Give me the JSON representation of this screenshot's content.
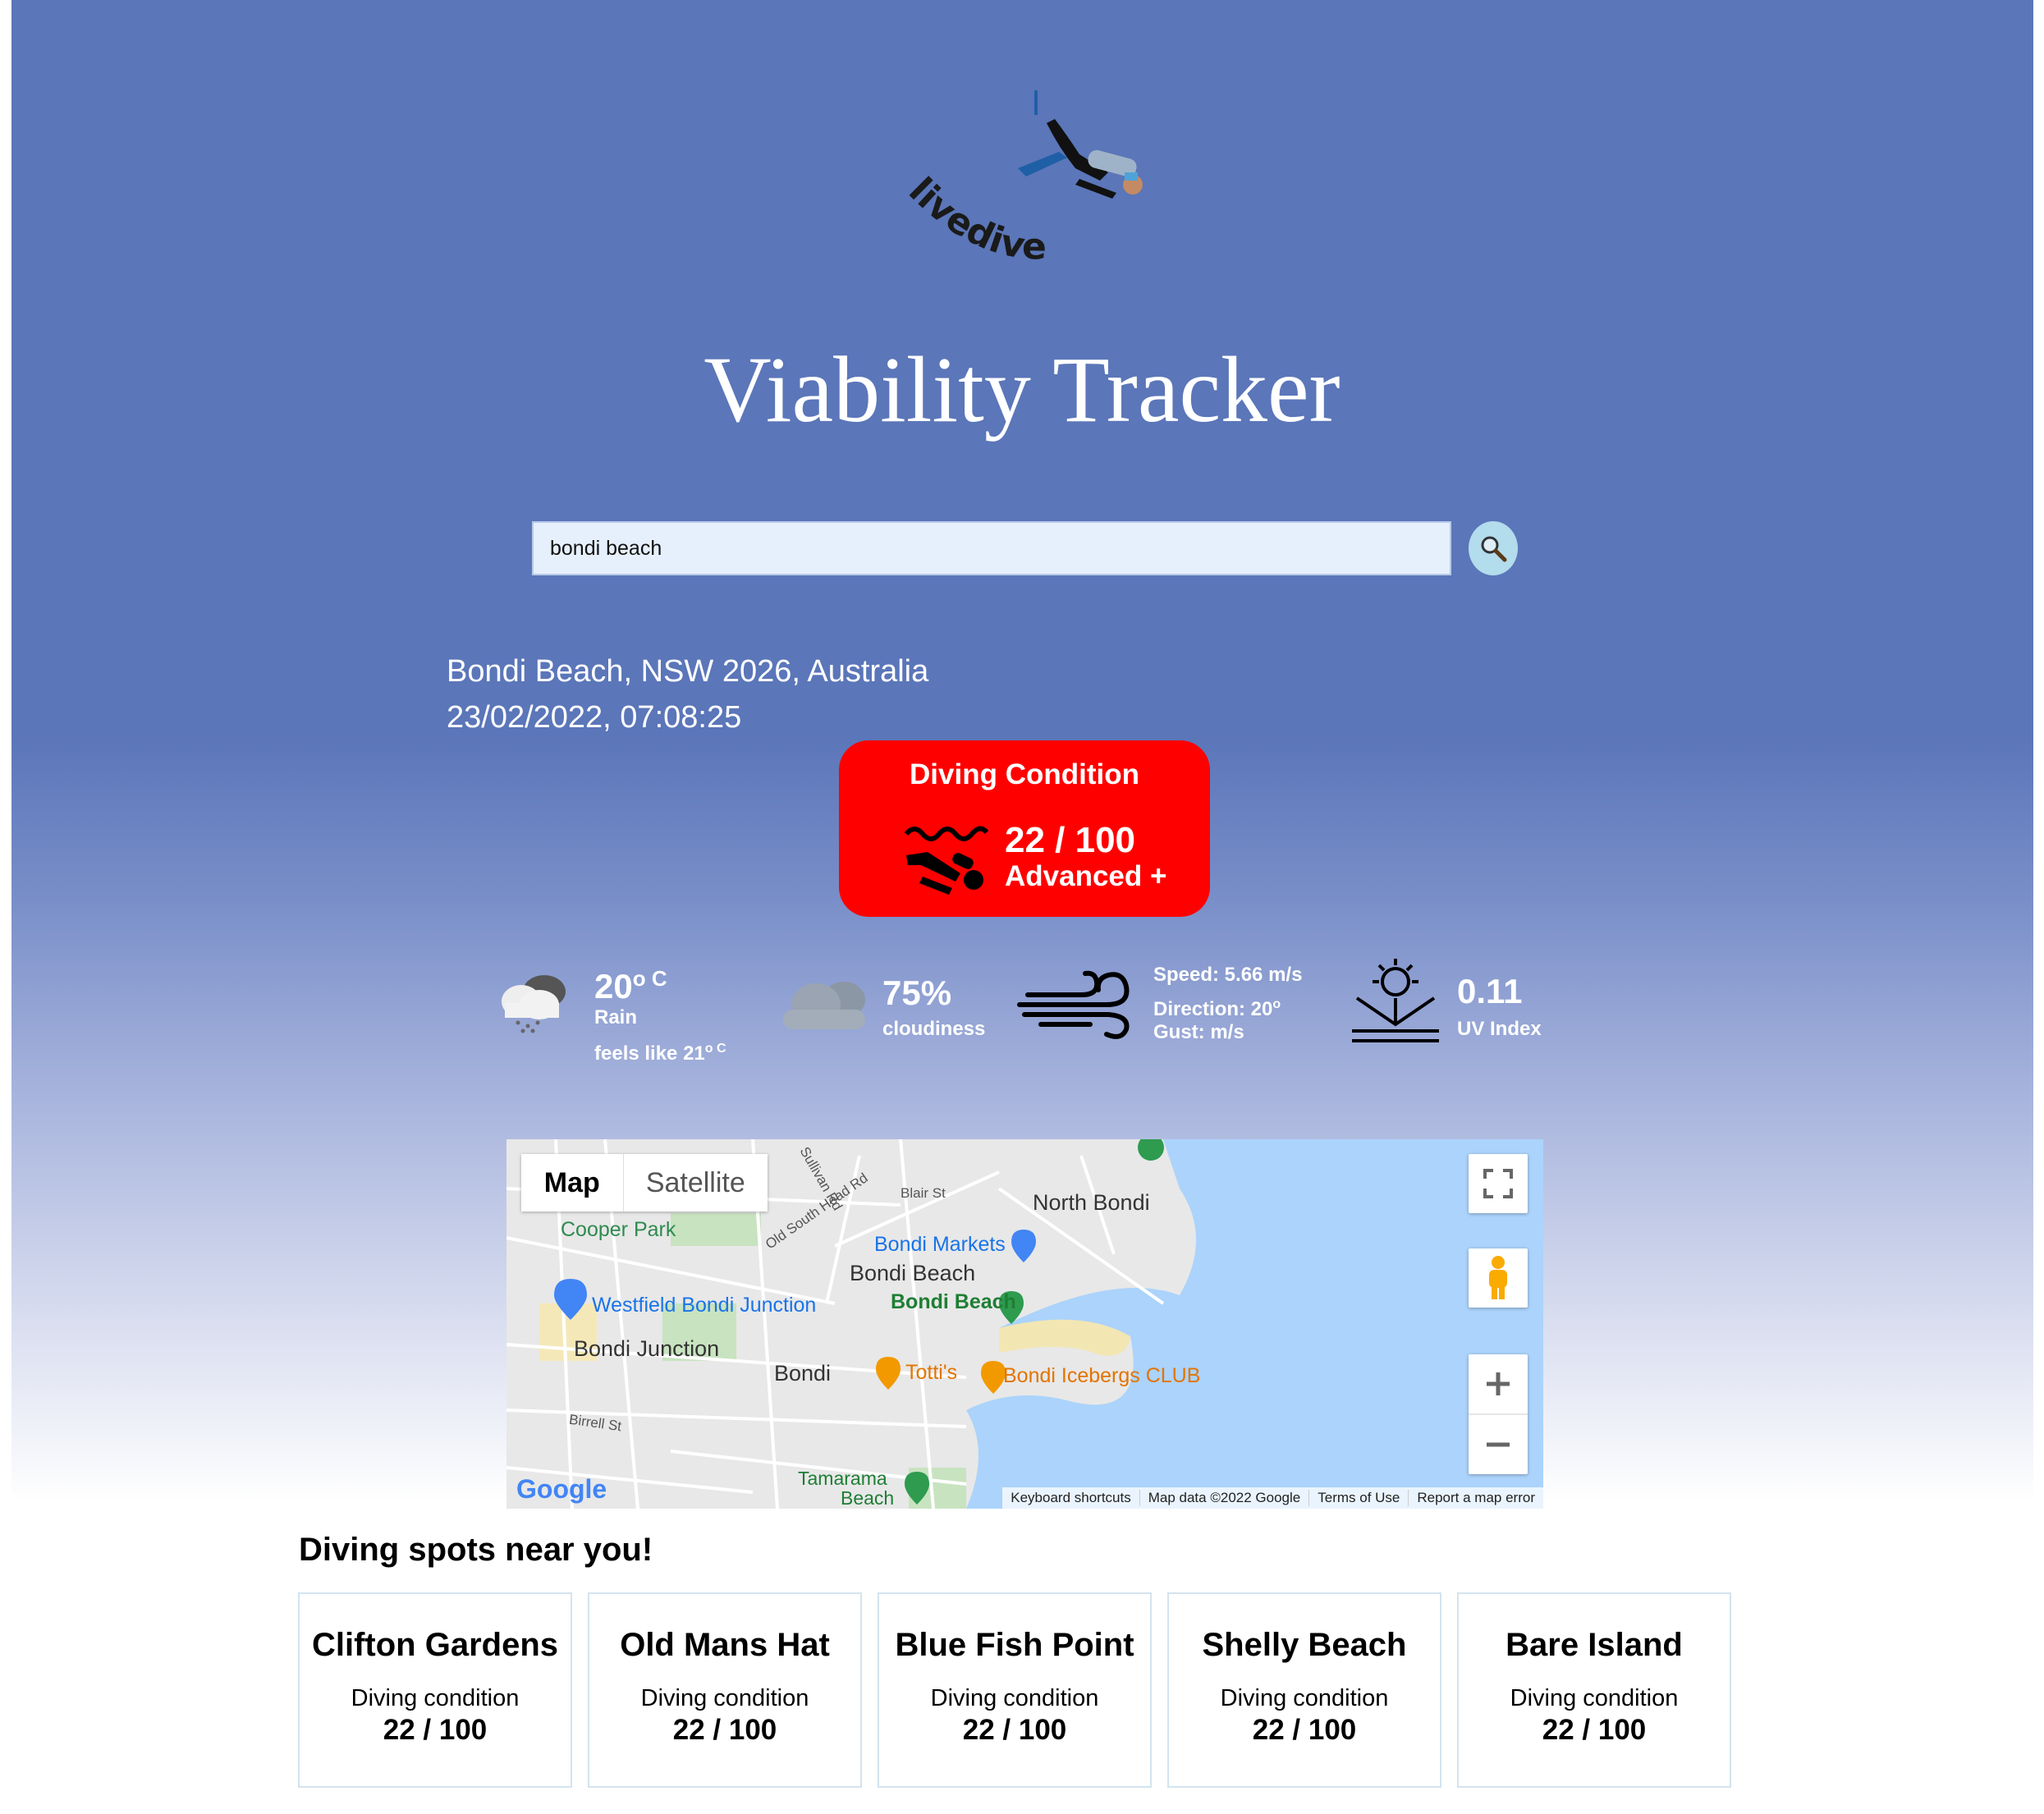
{
  "header": {
    "logo_text": "livedive",
    "title": "Viability Tracker"
  },
  "search": {
    "value": "bondi beach",
    "button_icon": "magnifier-icon"
  },
  "location": {
    "address": "Bondi Beach, NSW 2026, Australia",
    "datetime": "23/02/2022, 07:08:25"
  },
  "condition": {
    "title": "Diving Condition",
    "score": "22 / 100",
    "level": "Advanced +",
    "color": "#ff0000",
    "icon": "diver-icon"
  },
  "weather": {
    "temperature": {
      "icon": "rain-cloud-icon",
      "value": "20",
      "unit": "o C",
      "description": "Rain",
      "feels_like": "feels like 21",
      "feels_unit": "o C"
    },
    "cloudiness": {
      "icon": "cloud-icon",
      "value": "75%",
      "label": "cloudiness"
    },
    "wind": {
      "icon": "wind-icon",
      "speed": "Speed: 5.66 m/s",
      "direction": "Direction: 20",
      "direction_unit": "o",
      "gust": "Gust: m/s"
    },
    "uv": {
      "icon": "sunrise-icon",
      "value": "0.11",
      "label": "UV Index"
    }
  },
  "map": {
    "tabs": [
      "Map",
      "Satellite"
    ],
    "active_tab": "Map",
    "labels": {
      "north_bondi": "North Bondi",
      "cooper_park": "Cooper Park",
      "bondi_markets": "Bondi Markets",
      "bondi_beach_suburb": "Bondi Beach",
      "bondi_beach_poi": "Bondi Beach",
      "westfield": "Westfield Bondi Junction",
      "bondi_junction": "Bondi Junction",
      "bondi": "Bondi",
      "tottis": "Totti's",
      "icebergs": "Bondi Icebergs CLUB",
      "tamarama": "Tamarama",
      "tamarama_beach": "Beach",
      "blair_st": "Blair St",
      "old_south_head_rd": "Old South Head Rd",
      "birrell_st": "Birrell St",
      "sullivan_rd": "Sullivan Rd",
      "google": "Google"
    },
    "footer": [
      "Keyboard shortcuts",
      "Map data ©2022 Google",
      "Terms of Use",
      "Report a map error"
    ]
  },
  "nearby": {
    "title": "Diving spots near you!",
    "spots": [
      {
        "name": "Clifton Gardens",
        "label": "Diving condition",
        "score": "22 / 100"
      },
      {
        "name": "Old Mans Hat",
        "label": "Diving condition",
        "score": "22 / 100"
      },
      {
        "name": "Blue Fish Point",
        "label": "Diving condition",
        "score": "22 / 100"
      },
      {
        "name": "Shelly Beach",
        "label": "Diving condition",
        "score": "22 / 100"
      },
      {
        "name": "Bare Island",
        "label": "Diving condition",
        "score": "22 / 100"
      }
    ]
  }
}
